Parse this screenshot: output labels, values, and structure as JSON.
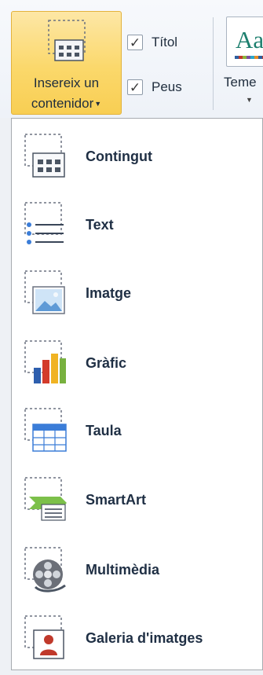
{
  "ribbon": {
    "insert_button": {
      "line1": "Insereix un",
      "line2": "contenidor",
      "icon": "insert-container-icon",
      "accent": "#fbd86b"
    },
    "checkboxes": [
      {
        "label": "Títol",
        "checked": true
      },
      {
        "label": "Peus",
        "checked": true
      }
    ],
    "themes": {
      "preview_text": "Aa",
      "label": "Teme"
    }
  },
  "menu": {
    "items": [
      {
        "label": "Contingut",
        "icon": "content-icon"
      },
      {
        "label": "Text",
        "icon": "text-list-icon"
      },
      {
        "label": "Imatge",
        "icon": "picture-icon"
      },
      {
        "label": "Gràfic",
        "icon": "chart-icon"
      },
      {
        "label": "Taula",
        "icon": "table-icon"
      },
      {
        "label": "SmartArt",
        "icon": "smartart-icon"
      },
      {
        "label": "Multimèdia",
        "icon": "film-reel-icon"
      },
      {
        "label": "Galeria d'imatges",
        "icon": "picture-gallery-icon"
      }
    ]
  }
}
